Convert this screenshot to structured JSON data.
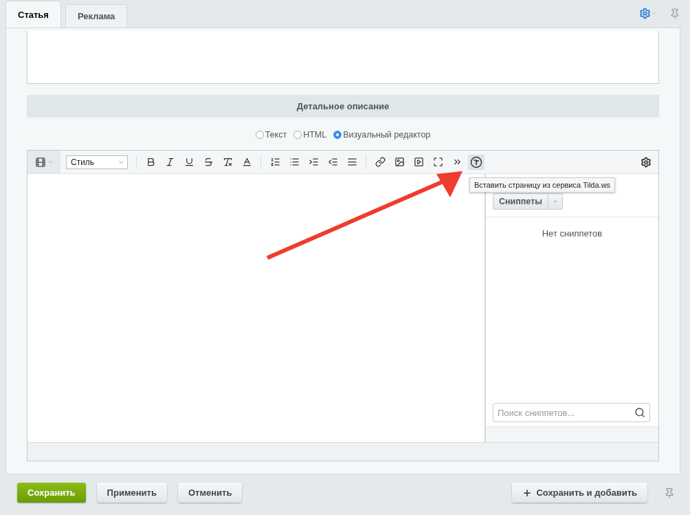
{
  "tabs": [
    {
      "label": "Статья",
      "selected": true
    },
    {
      "label": "Реклама",
      "selected": false
    }
  ],
  "section_title": "Детальное описание",
  "modes": [
    {
      "label": "Текст",
      "selected": false
    },
    {
      "label": "HTML",
      "selected": false
    },
    {
      "label": "Визуальный редактор",
      "selected": true
    }
  ],
  "toolbar": {
    "style_select": "Стиль",
    "tooltip": "Вставить страницу из сервиса Tilda.ws"
  },
  "snippets": {
    "button": "Сниппеты",
    "empty": "Нет сниппетов",
    "search_placeholder": "Поиск сниппетов..."
  },
  "buttons": [
    {
      "label": "Сохранить",
      "kind": "primary"
    },
    {
      "label": "Применить",
      "kind": "default"
    },
    {
      "label": "Отменить",
      "kind": "default"
    }
  ],
  "save_add_button": "Сохранить и добавить"
}
